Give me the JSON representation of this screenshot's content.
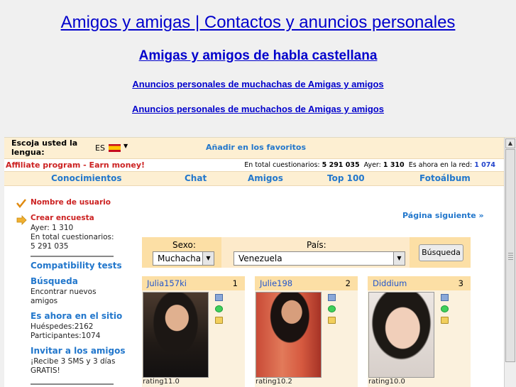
{
  "header": {
    "title": "Amigos y amigas | Contactos y anuncios personales",
    "subtitle": "Amigas y amigos de habla castellana",
    "link_girls": "Anuncios personales de muchachas de Amigas y amigos",
    "link_boys": "Anuncios personales de muchachos de Amigas y amigos"
  },
  "langbar": {
    "label": "Escoja usted la lengua:",
    "code": "ES",
    "favorites": "Añadir en los favoritos"
  },
  "stats": {
    "affiliate": "Affiliate program - Earn money!",
    "total_label": "En total cuestionarios:",
    "total_value": "5 291 035",
    "yesterday_label": "Ayer:",
    "yesterday_value": "1 310",
    "online_label": "Es ahora en la red:",
    "online_value": "1 074"
  },
  "nav": [
    "Conocimientos",
    "Chat",
    "Amigos",
    "Top 100",
    "Fotoálbum"
  ],
  "sidebar": {
    "username": "Nombre de usuario",
    "create_survey": "Crear encuesta",
    "yesterday": "Ayer: 1 310",
    "total_line1": "En total cuestionarios:",
    "total_line2": "5 291 035",
    "compat": "Compatibility tests",
    "search_title": "Búsqueda",
    "search_desc1": "Encontrar nuevos",
    "search_desc2": "amigos",
    "online_title": "Es ahora en el sitio",
    "guests": "Huéspedes:2162",
    "participants": "Participantes:1074",
    "invite_title": "Invitar a los amigos",
    "invite_desc1": "¡Recibe 3 SMS y 3 días",
    "invite_desc2": "GRATIS!"
  },
  "main": {
    "next_page": "Página siguiente »",
    "search": {
      "sex_label": "Sexo:",
      "sex_value": "Muchacha",
      "country_label": "País:",
      "country_value": "Venezuela",
      "button": "Búsqueda"
    },
    "cards": [
      {
        "name": "Julia157ki",
        "rank": "1",
        "rating": "rating11.0"
      },
      {
        "name": "Julie198",
        "rank": "2",
        "rating": "rating10.2"
      },
      {
        "name": "Diddium",
        "rank": "3",
        "rating": "rating10.0"
      }
    ]
  },
  "colors": {
    "link_blue": "#0000cc",
    "accent_blue": "#2277cc",
    "accent_red": "#cc2222",
    "panel_bg": "#fdefd2",
    "search_bg": "#fcdfa5"
  }
}
